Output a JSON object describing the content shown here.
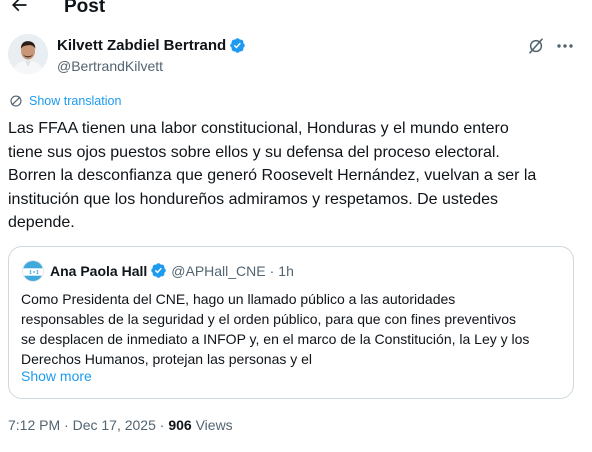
{
  "header": {
    "title": "Post",
    "back_icon": "arrow-left-icon"
  },
  "author": {
    "name": "Kilvett Zabdiel Bertrand",
    "handle": "@BertrandKilvett",
    "verified_color": "#1d9bf0"
  },
  "actions": {
    "grok_icon": "grok-icon",
    "more_icon": "more-horizontal-icon"
  },
  "translation": {
    "label": "Show translation",
    "color": "#1d9bf0"
  },
  "tweet": {
    "text": "Las FFAA tienen una labor constitucional, Honduras y el mundo entero\ntiene sus ojos puestos sobre ellos y su defensa del proceso electoral.\nBorren la desconfianza que generó Roosevelt Hernández, vuelvan a ser la\ninstitución que los hondureños admiramos y respetamos. De ustedes\ndepende."
  },
  "quote": {
    "name": "Ana Paola Hall",
    "handle": "@APHall_CNE",
    "separator": "·",
    "time": "1h",
    "text": "Como Presidenta del CNE, hago un llamado público a las autoridades\nresponsables de la seguridad y el orden público, para que con fines preventivos\nse desplacen de inmediato a INFOP y, en el marco de la Constitución, la Ley y los\nDerechos Humanos, protejan las personas y el",
    "show_more": "Show more",
    "avatar_colors": {
      "flag_blue": "#3fa9dc",
      "flag_white": "#ffffff"
    }
  },
  "meta": {
    "time": "7:12 PM",
    "separator1": "·",
    "date": "Dec 17, 2025",
    "separator2": "·",
    "views_count": "906",
    "views_label": "Views"
  }
}
